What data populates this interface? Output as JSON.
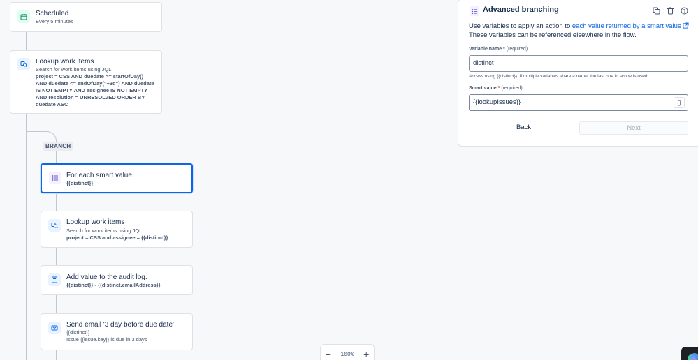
{
  "flow": {
    "trigger": {
      "title": "Scheduled",
      "subtitle": "Every 5 minutes"
    },
    "lookup1": {
      "title": "Lookup work items",
      "subtitle": "Search for work items using JQL",
      "query": "project = CSS AND duedate >= startOfDay() AND duedate <= endOfDay(\"+3d\") AND duedate IS NOT EMPTY AND assignee IS NOT EMPTY AND resolution = UNRESOLVED ORDER BY duedate ASC"
    },
    "branch_label": "BRANCH",
    "foreach": {
      "title": "For each smart value",
      "value": "{{distinct}}"
    },
    "lookup2": {
      "title": "Lookup work items",
      "subtitle": "Search for work items using JQL",
      "query": "project = CSS and assignee = {{distinct}}"
    },
    "audit": {
      "title": "Add value to the audit log.",
      "value": "{{distinct}} - {{distinct.emailAddress}}"
    },
    "email": {
      "title": "Send email '3 day before due date'",
      "to": "{{distinct}}",
      "body": "Issue {{issue.key}} is due in 3 days"
    }
  },
  "zoom": {
    "level": "100%",
    "minus": "−",
    "plus": "+"
  },
  "panel": {
    "title": "Advanced branching",
    "desc_prefix": "Use variables to apply an action to ",
    "desc_link": "each value returned by a smart value",
    "desc_suffix": ". These variables can be referenced elsewhere in the flow.",
    "var_label": "Variable name",
    "required_star": "*",
    "required_text": "(required)",
    "var_value": "distinct",
    "hint": "Access using {{distinct}}. If multiple variables share a name, the last one in scope is used.",
    "smart_label": "Smart value",
    "smart_value": "{{lookupIssues}}",
    "brace_btn": "{}",
    "back": "Back",
    "next": "Next"
  },
  "colors": {
    "accent": "#0c66e4",
    "trigger_icon": "#1f845a",
    "action_icon": "#0c66e4",
    "branch_icon": "#6e5dc6"
  }
}
